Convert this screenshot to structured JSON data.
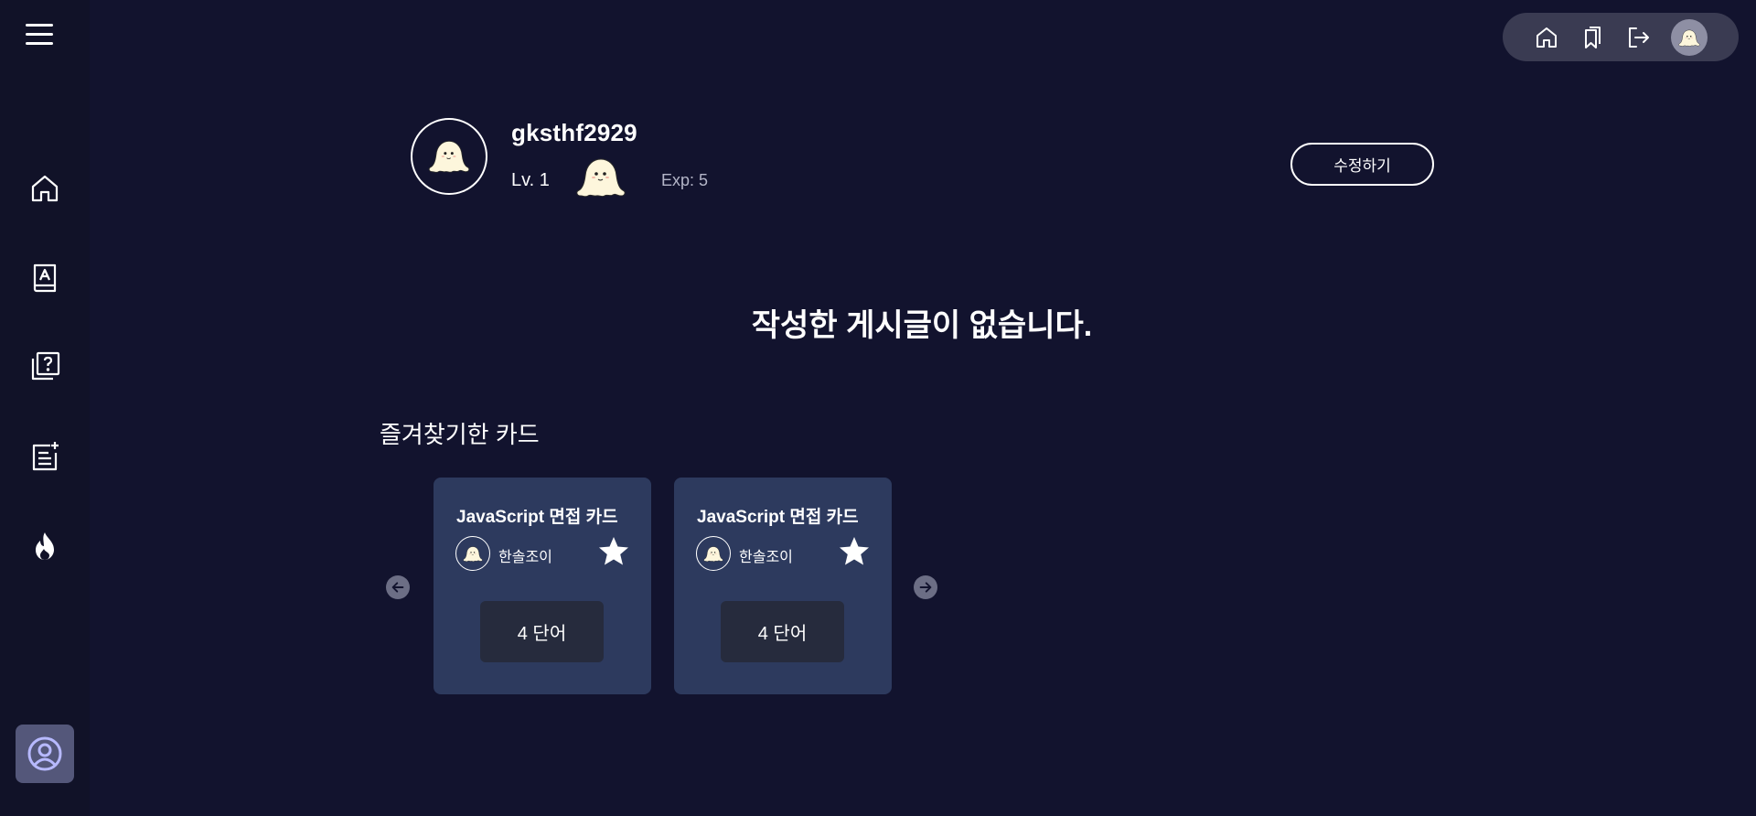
{
  "sidebar": {
    "items": [
      {
        "name": "home",
        "icon": "home-icon"
      },
      {
        "name": "wordbook",
        "icon": "book-icon"
      },
      {
        "name": "quiz",
        "icon": "question-cards-icon"
      },
      {
        "name": "write",
        "icon": "note-add-icon"
      },
      {
        "name": "popular",
        "icon": "fire-icon"
      }
    ],
    "active_item": {
      "name": "profile",
      "icon": "user-circle-icon"
    }
  },
  "topbar": {
    "icons": [
      "home-icon",
      "bookmark-icon",
      "logout-icon",
      "avatar"
    ]
  },
  "profile": {
    "username": "gksthf2929",
    "level": "Lv. 1",
    "exp": "Exp: 5",
    "edit_label": "수정하기"
  },
  "posts": {
    "empty_message": "작성한 게시글이 없습니다."
  },
  "favorites": {
    "title": "즐겨찾기한 카드",
    "cards": [
      {
        "title": "JavaScript 면접 카드",
        "author": "한솔조이",
        "word_count": "4 단어",
        "starred": true
      },
      {
        "title": "JavaScript 면접 카드",
        "author": "한솔조이",
        "word_count": "4 단어",
        "starred": true
      }
    ]
  },
  "colors": {
    "background": "#12132e",
    "card": "#2d3a5e",
    "word_box": "#262b3d",
    "active_nav": "#54577a",
    "topbar": "#3a3b52"
  }
}
